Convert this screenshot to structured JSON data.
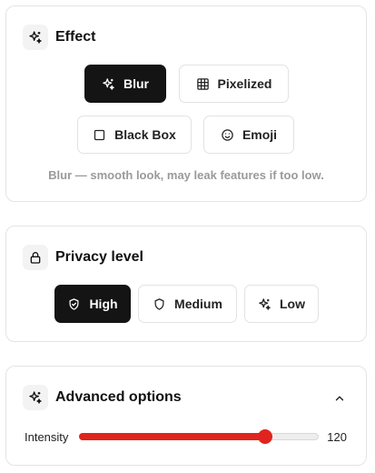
{
  "effect": {
    "title": "Effect",
    "icon": "sparkle-icon",
    "options": [
      {
        "label": "Blur",
        "icon": "sparkle-icon",
        "active": true
      },
      {
        "label": "Pixelized",
        "icon": "grid-icon",
        "active": false
      },
      {
        "label": "Black Box",
        "icon": "square-icon",
        "active": false
      },
      {
        "label": "Emoji",
        "icon": "smiley-icon",
        "active": false
      }
    ],
    "hint": "Blur — smooth look, may leak features if too low."
  },
  "privacy": {
    "title": "Privacy level",
    "icon": "lock-icon",
    "options": [
      {
        "label": "High",
        "icon": "shield-check-icon",
        "active": true
      },
      {
        "label": "Medium",
        "icon": "shield-icon",
        "active": false
      },
      {
        "label": "Low",
        "icon": "sparkle-icon",
        "active": false
      }
    ]
  },
  "advanced": {
    "title": "Advanced options",
    "icon": "sparkle-icon",
    "expanded": true,
    "intensity": {
      "label": "Intensity",
      "value": "120",
      "fraction": 0.78
    }
  },
  "colors": {
    "active_bg": "#141414",
    "accent": "#e0241d",
    "hint": "#9a9a9a"
  }
}
